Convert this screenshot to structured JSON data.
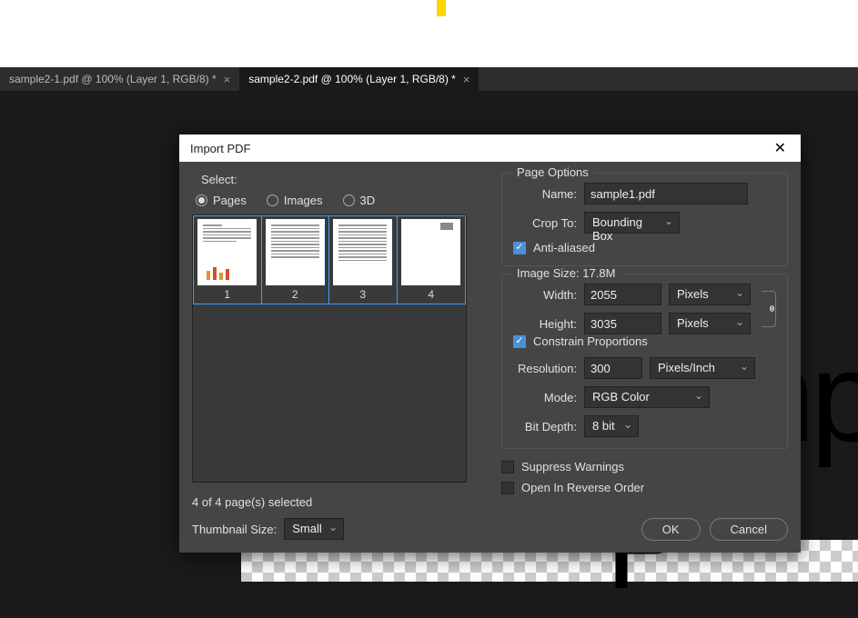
{
  "tabs": [
    {
      "label": "sample2-1.pdf @ 100% (Layer 1, RGB/8) *",
      "active": false
    },
    {
      "label": "sample2-2.pdf @ 100% (Layer 1, RGB/8) *",
      "active": true
    }
  ],
  "canvas": {
    "big_text": "Simple P"
  },
  "dialog": {
    "title": "Import PDF",
    "select_label": "Select:",
    "radios": {
      "pages": "Pages",
      "images": "Images",
      "threeD": "3D"
    },
    "thumbs": [
      "1",
      "2",
      "3",
      "4"
    ],
    "status": "4 of 4 page(s) selected",
    "thumb_size_label": "Thumbnail Size:",
    "thumb_size_value": "Small",
    "page_options": {
      "legend": "Page Options",
      "name_label": "Name:",
      "name_value": "sample1.pdf",
      "crop_label": "Crop To:",
      "crop_value": "Bounding Box",
      "aa_label": "Anti-aliased"
    },
    "image_size": {
      "legend_prefix": "Image Size: ",
      "size": "17.8M",
      "width_label": "Width:",
      "width_value": "2055",
      "width_unit": "Pixels",
      "height_label": "Height:",
      "height_value": "3035",
      "height_unit": "Pixels",
      "constrain_label": "Constrain Proportions",
      "res_label": "Resolution:",
      "res_value": "300",
      "res_unit": "Pixels/Inch",
      "mode_label": "Mode:",
      "mode_value": "RGB Color",
      "depth_label": "Bit Depth:",
      "depth_value": "8 bit"
    },
    "suppress_label": "Suppress Warnings",
    "reverse_label": "Open In Reverse Order",
    "ok": "OK",
    "cancel": "Cancel"
  }
}
